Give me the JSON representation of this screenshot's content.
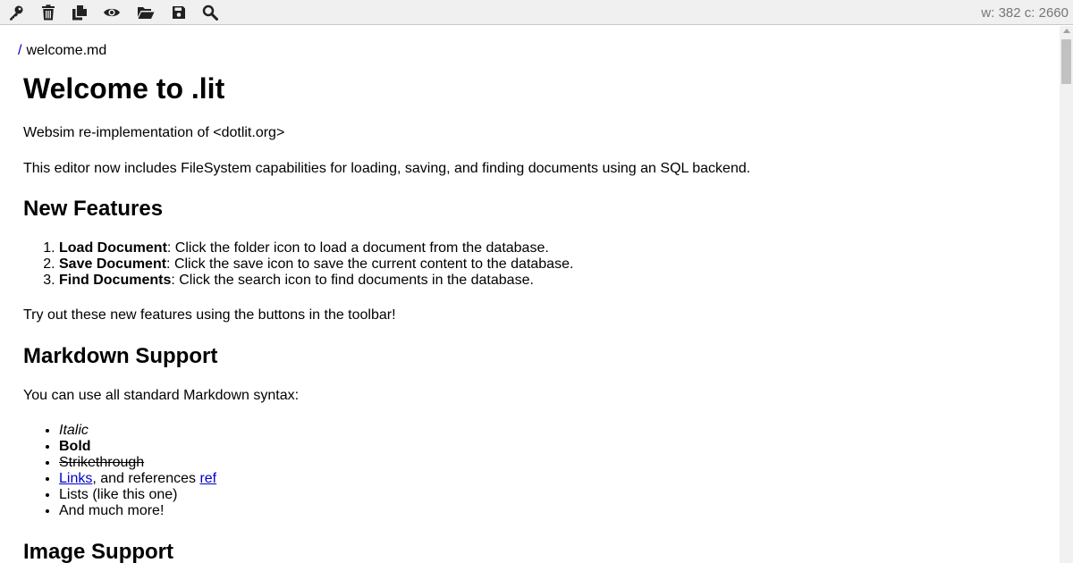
{
  "toolbar": {
    "buttons": [
      {
        "icon": "key-icon"
      },
      {
        "icon": "trash-icon"
      },
      {
        "icon": "copy-icon"
      },
      {
        "icon": "eye-icon"
      },
      {
        "icon": "folder-open-icon"
      },
      {
        "icon": "save-icon"
      },
      {
        "icon": "search-icon"
      }
    ],
    "stats": "w: 382 c: 2660"
  },
  "breadcrumb": {
    "separator": "/",
    "file": "welcome.md"
  },
  "doc": {
    "title": "Welcome to .lit",
    "intro": "Websim re-implementation of <dotlit.org>",
    "fs_paragraph": "This editor now includes FileSystem capabilities for loading, saving, and finding documents using an SQL backend.",
    "features_heading": "New Features",
    "features": [
      {
        "bold": "Load Document",
        "text": ": Click the folder icon to load a document from the database."
      },
      {
        "bold": "Save Document",
        "text": ": Click the save icon to save the current content to the database."
      },
      {
        "bold": "Find Documents",
        "text": ": Click the search icon to find documents in the database."
      }
    ],
    "try_text": "Try out these new features using the buttons in the toolbar!",
    "markdown_heading": "Markdown Support",
    "markdown_intro": "You can use all standard Markdown syntax:",
    "md_list": {
      "italic": "Italic",
      "bold": "Bold",
      "strike": "Strikethrough",
      "links_link": "Links",
      "links_mid": ", and references ",
      "links_ref": "ref",
      "lists": "Lists (like this one)",
      "more": "And much more!"
    },
    "image_heading": "Image Support"
  },
  "colors": {
    "toolbar_bg": "#f0f0f0",
    "icon": "#222222",
    "link": "#0000cc",
    "stats": "#777777"
  }
}
